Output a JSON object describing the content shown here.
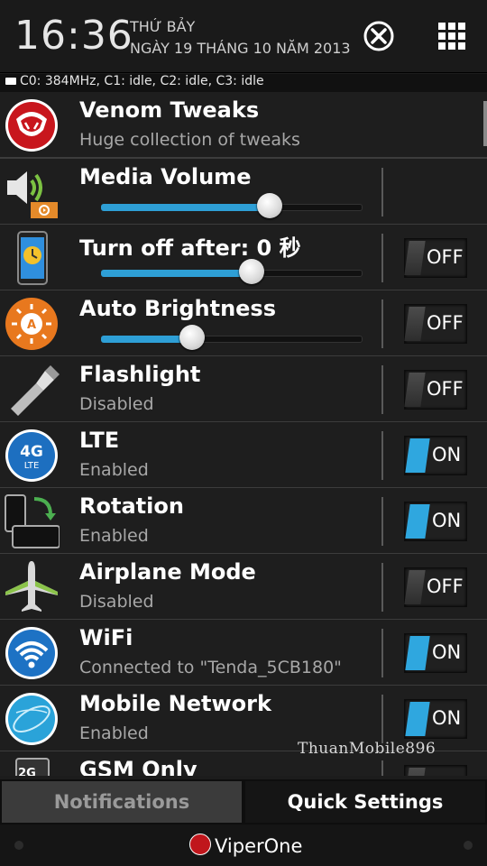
{
  "header": {
    "time": "16:36",
    "day": "THỨ BẢY",
    "date": "NGÀY 19 THÁNG 10 NĂM 2013"
  },
  "cpu_status": "C0: 384MHz, C1: idle, C2: idle, C3: idle",
  "rows": [
    {
      "title": "Venom Tweaks",
      "subtitle": "Huge collection of tweaks",
      "icon": "venom-logo-icon"
    },
    {
      "title": "Media Volume",
      "slider_level": 0.65,
      "icon": "speaker-icon"
    },
    {
      "title": "Turn off after: 0 秒",
      "slider_level": 0.58,
      "toggle": "OFF",
      "icon": "phone-timer-icon"
    },
    {
      "title": "Auto Brightness",
      "slider_level": 0.35,
      "toggle": "OFF",
      "icon": "brightness-icon"
    },
    {
      "title": "Flashlight",
      "subtitle": "Disabled",
      "toggle": "OFF",
      "icon": "flashlight-icon"
    },
    {
      "title": "LTE",
      "subtitle": "Enabled",
      "toggle": "ON",
      "icon": "lte-icon"
    },
    {
      "title": "Rotation",
      "subtitle": "Enabled",
      "toggle": "ON",
      "icon": "rotation-icon"
    },
    {
      "title": "Airplane Mode",
      "subtitle": "Disabled",
      "toggle": "OFF",
      "icon": "airplane-icon"
    },
    {
      "title": "WiFi",
      "subtitle": "Connected to \"Tenda_5CB180\"",
      "toggle": "ON",
      "icon": "wifi-icon"
    },
    {
      "title": "Mobile Network",
      "subtitle": "Enabled",
      "toggle": "ON",
      "icon": "globe-icon"
    },
    {
      "title": "GSM Only",
      "icon": "sim-2g-icon"
    }
  ],
  "tabs": {
    "notifications": "Notifications",
    "quick_settings": "Quick Settings"
  },
  "footer": {
    "brand": "ViperOne"
  },
  "watermark": "ThuanMobile896",
  "colors": {
    "accent": "#2ea6de",
    "background": "#1e1e1e",
    "divider": "#3c3c3c"
  }
}
